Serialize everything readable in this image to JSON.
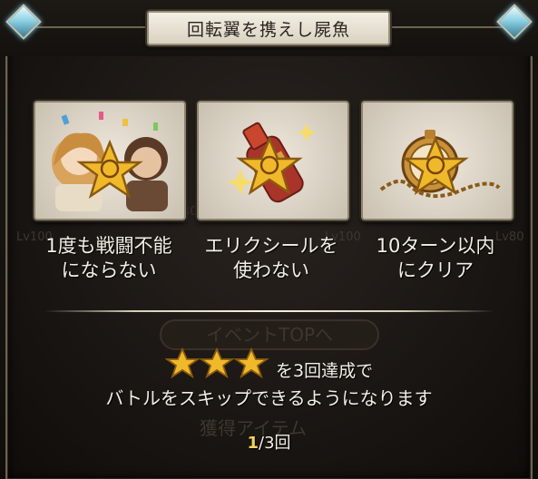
{
  "title": "回転翼を携えし屍魚",
  "challenges": [
    {
      "label_line1": "1度も戦闘不能",
      "label_line2": "にならない",
      "icon": "characters-star-icon"
    },
    {
      "label_line1": "エリクシールを",
      "label_line2": "使わない",
      "icon": "potion-star-icon"
    },
    {
      "label_line1": "10ターン以内",
      "label_line2": "にクリア",
      "icon": "pocket-watch-star-icon"
    }
  ],
  "condition_text": "を3回達成で",
  "skip_text": "バトルをスキップできるようになります",
  "progress": {
    "current": "1",
    "total": "/3回"
  },
  "background_ghost": {
    "levels": [
      "Lv100",
      "Lv80",
      "Lv100",
      "Lv80"
    ],
    "event_button": "イベントTOPへ",
    "reward_label": "獲得アイテム"
  },
  "colors": {
    "star_gold": "#f0b92a",
    "text": "#f3efe6",
    "progress_current": "#f2d45a",
    "gem": "#8fd2e6"
  }
}
